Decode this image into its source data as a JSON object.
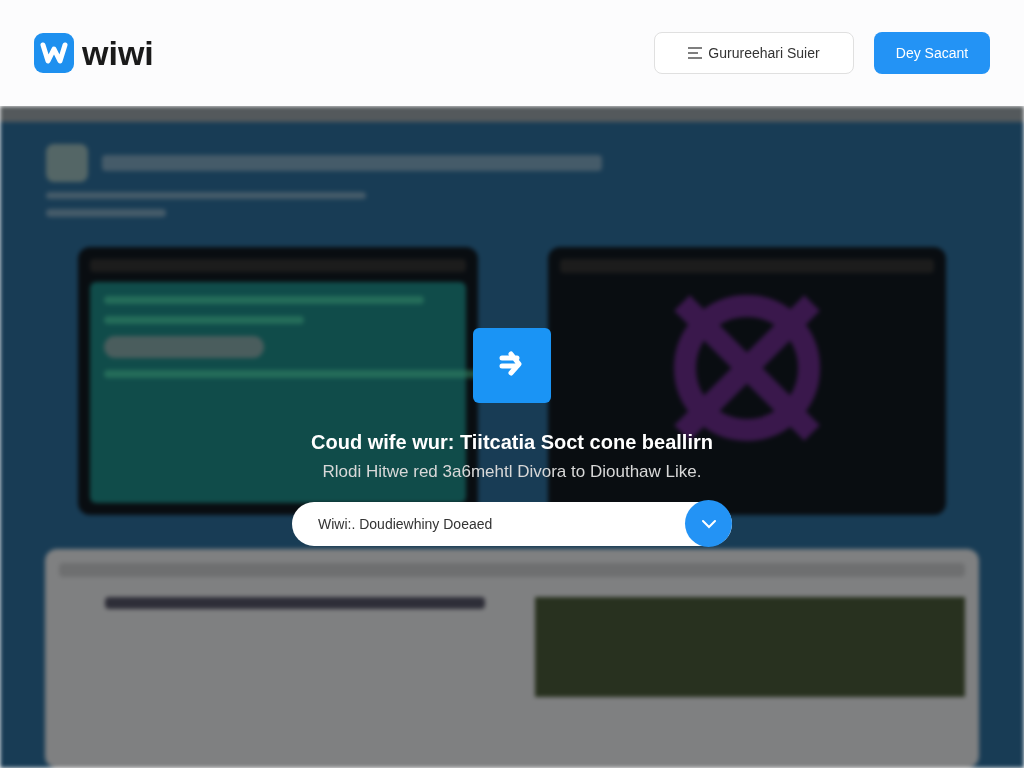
{
  "header": {
    "logo_text": "wiwi",
    "secondary_button": "Gurureehari Suier",
    "primary_button": "Dey Sacant"
  },
  "overlay": {
    "title": "Coud wife wur: Tiitcatia Soct cone beallirn",
    "subtitle": "Rlodi Hitwe red 3a6mehtl Divora to Diouthaw Like.",
    "field": {
      "value": "Wiwi:. Doudiewhiny Doeaed"
    }
  }
}
